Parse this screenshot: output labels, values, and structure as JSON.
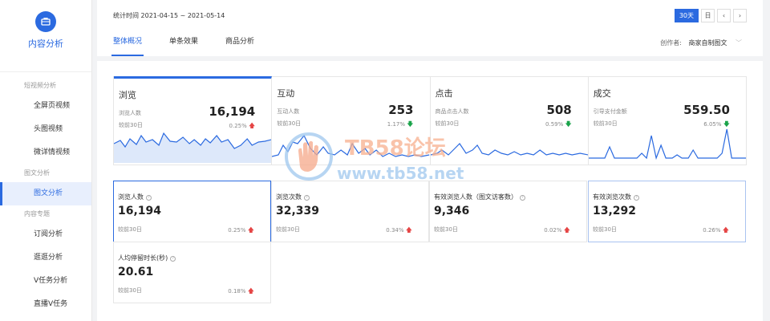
{
  "sidebar": {
    "title": "内容分析",
    "icon": "briefcase-icon",
    "groups": [
      {
        "title": "短视频分析",
        "items": [
          "全屏页视频",
          "头图视频",
          "微详情视频"
        ]
      },
      {
        "title": "图文分析",
        "items": [
          "图文分析"
        ]
      },
      {
        "title": "内容专题",
        "items": [
          "订阅分析",
          "逛逛分析",
          "V任务分析",
          "直播V任务"
        ]
      }
    ],
    "active_item": "图文分析"
  },
  "header": {
    "date_range": "统计时间 2021-04-15 ~ 2021-05-14",
    "range_buttons": {
      "days30": "30天",
      "day": "日",
      "prev": "‹",
      "next": "›"
    },
    "tabs": [
      "整体概况",
      "单条效果",
      "商品分析"
    ],
    "creator_label": "创作者:",
    "creator_value": "商家自制图文"
  },
  "top_cards": [
    {
      "title": "浏览",
      "label": "浏览人数",
      "value": "16,194",
      "compare": "较前30日",
      "pct": "0.25%",
      "trend": "up",
      "active": true
    },
    {
      "title": "互动",
      "label": "互动人数",
      "value": "253",
      "compare": "较前30日",
      "pct": "1.17%",
      "trend": "down",
      "active": false
    },
    {
      "title": "点击",
      "label": "商品点击人数",
      "value": "508",
      "compare": "较前30日",
      "pct": "0.59%",
      "trend": "down",
      "active": false
    },
    {
      "title": "成交",
      "label": "引导支付金额",
      "value": "559.50",
      "compare": "较前30日",
      "pct": "6.05%",
      "trend": "down",
      "active": false
    }
  ],
  "metric_cards": [
    {
      "label": "浏览人数",
      "value": "16,194",
      "compare": "较前30日",
      "pct": "0.25%",
      "trend": "up"
    },
    {
      "label": "浏览次数",
      "value": "32,339",
      "compare": "较前30日",
      "pct": "0.34%",
      "trend": "up"
    },
    {
      "label": "有效浏览人数（图文访客数）",
      "value": "9,346",
      "compare": "较前30日",
      "pct": "0.02%",
      "trend": "up"
    },
    {
      "label": "有效浏览次数",
      "value": "13,292",
      "compare": "较前30日",
      "pct": "0.26%",
      "trend": "up"
    },
    {
      "label": "人均停留时长(秒)",
      "value": "20.61",
      "compare": "较前30日",
      "pct": "0.18%",
      "trend": "up"
    }
  ],
  "watermark": {
    "line1": "TB58论坛",
    "line2": "www.tb58.net"
  },
  "colors": {
    "accent": "#2b6ae0",
    "up": "#e54545",
    "down": "#1aa34a"
  }
}
